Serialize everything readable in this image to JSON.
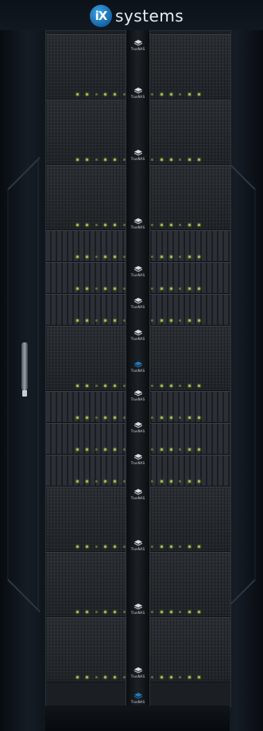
{
  "brand": {
    "badge_text": "iX",
    "wordmark": "systems"
  },
  "product_badge": {
    "label": "TrueNAS",
    "icon": "truenas-mark-icon"
  },
  "colors": {
    "brand_blue": "#1f7ac0",
    "led_green": "#9bc04a",
    "chassis": "#23272c",
    "rack": "#0d1218"
  },
  "units": [
    {
      "kind": "full",
      "name": "storage-unit-1"
    },
    {
      "kind": "full",
      "name": "storage-unit-2"
    },
    {
      "kind": "full",
      "name": "storage-unit-3"
    },
    {
      "kind": "slim",
      "name": "storage-unit-4"
    },
    {
      "kind": "slim",
      "name": "storage-unit-5"
    },
    {
      "kind": "slim",
      "name": "storage-unit-6"
    },
    {
      "kind": "full",
      "name": "storage-unit-7"
    },
    {
      "kind": "slim",
      "name": "storage-unit-8"
    },
    {
      "kind": "slim",
      "name": "storage-unit-9"
    },
    {
      "kind": "slim",
      "name": "storage-unit-10"
    },
    {
      "kind": "full",
      "name": "storage-unit-11"
    },
    {
      "kind": "full",
      "name": "storage-unit-12"
    },
    {
      "kind": "full",
      "name": "storage-unit-13"
    }
  ],
  "badges": [
    {
      "highlight": false
    },
    {
      "highlight": false
    },
    {
      "highlight": false
    },
    {
      "highlight": false
    },
    {
      "highlight": false
    },
    {
      "highlight": false
    },
    {
      "highlight": false
    },
    {
      "highlight": true
    },
    {
      "highlight": false
    },
    {
      "highlight": false
    },
    {
      "highlight": false
    },
    {
      "highlight": false
    },
    {
      "highlight": false
    },
    {
      "highlight": false
    },
    {
      "highlight": false
    },
    {
      "highlight": true
    }
  ]
}
